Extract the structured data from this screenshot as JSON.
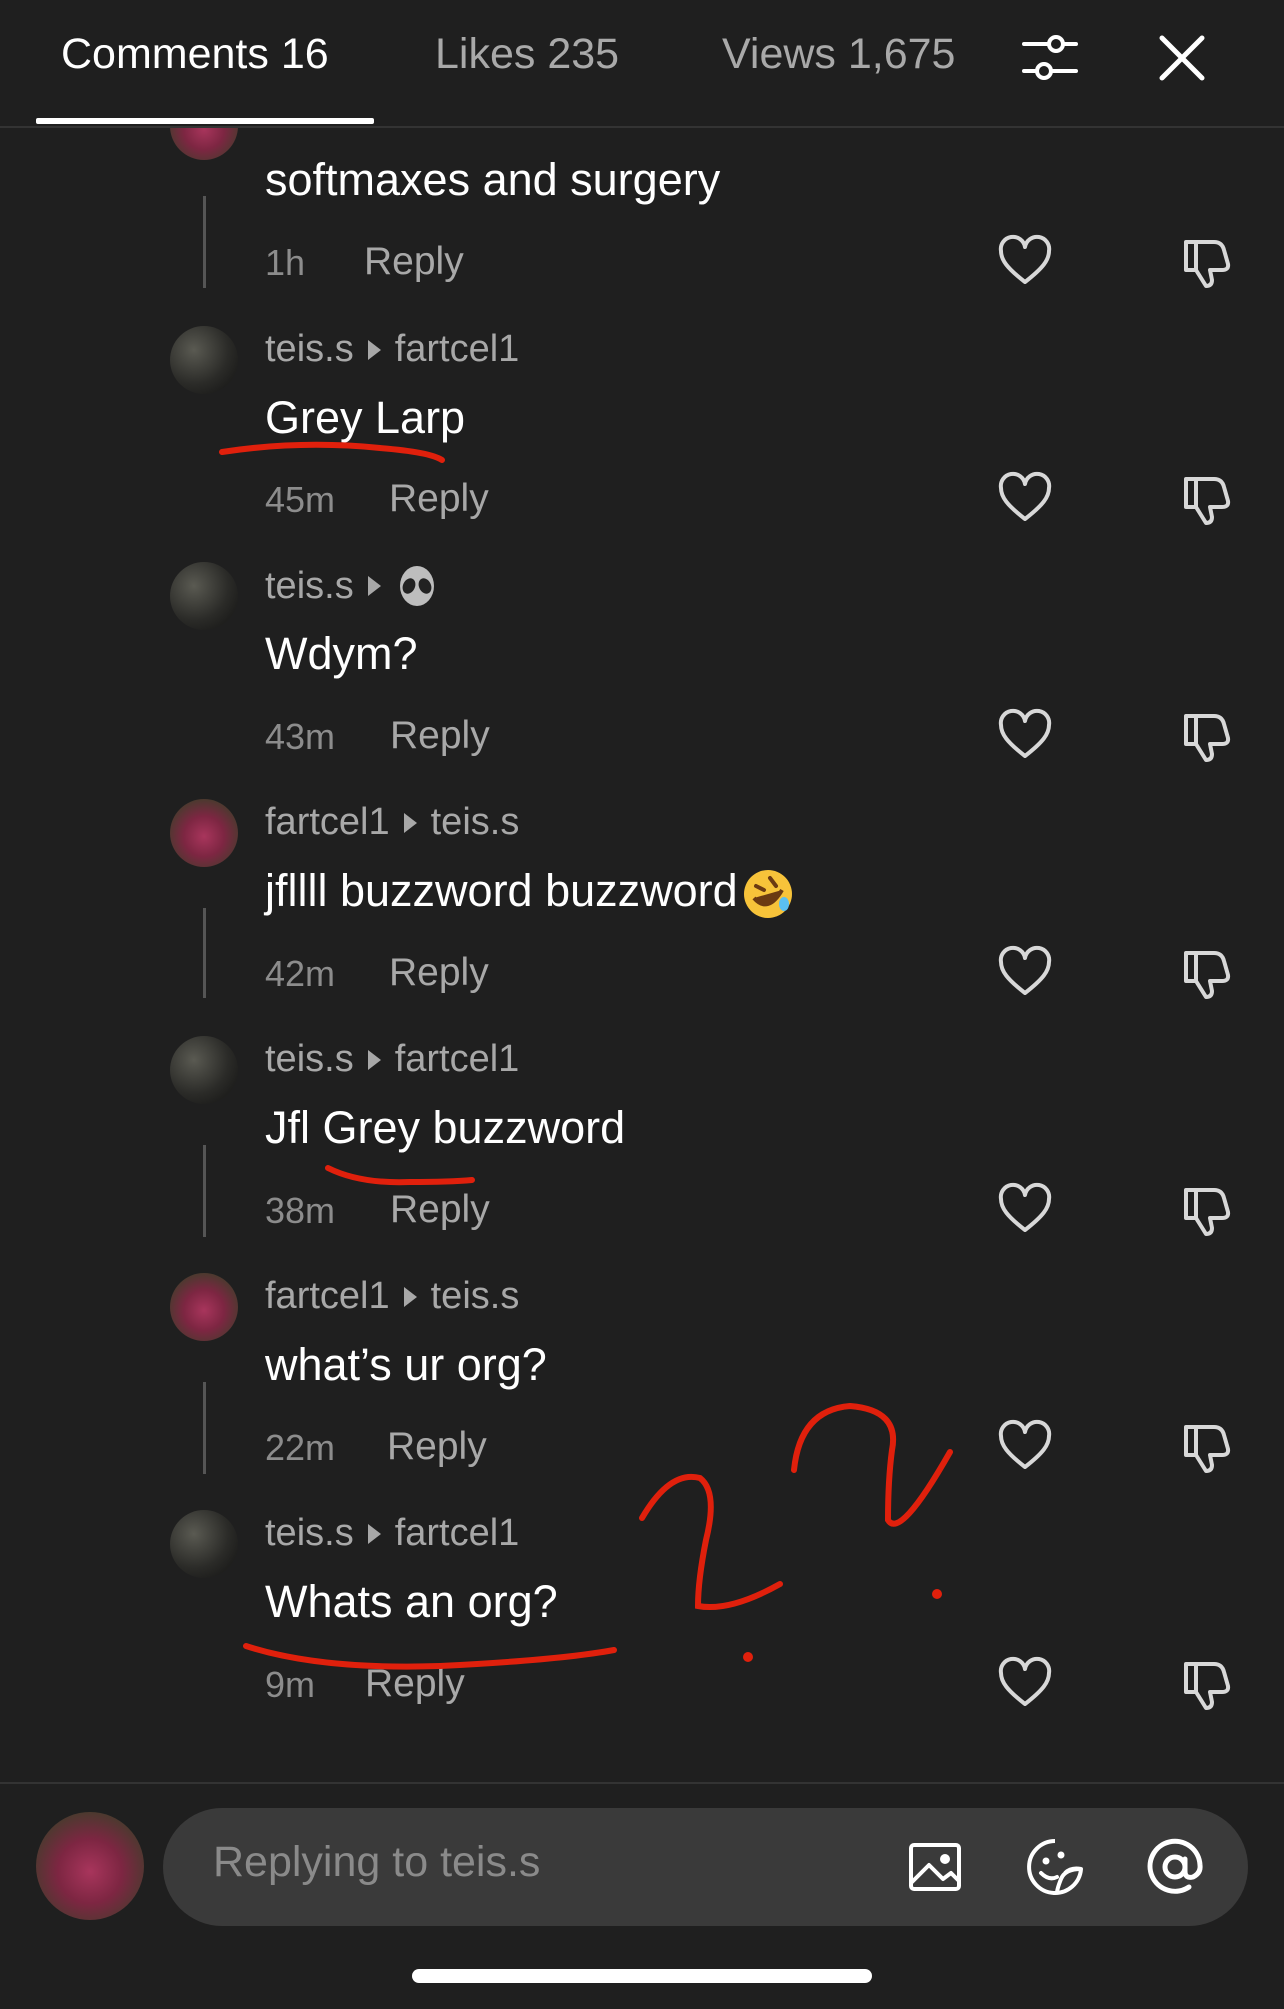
{
  "tabs": {
    "comments": "Comments 16",
    "likes": "Likes 235",
    "views": "Views 1,675"
  },
  "comments": [
    {
      "text": "softmaxes and surgery",
      "time": "1h",
      "reply": "Reply"
    },
    {
      "author": "teis.s",
      "target": "fartcel1",
      "text": "Grey Larp",
      "time": "45m",
      "reply": "Reply"
    },
    {
      "author": "teis.s",
      "target_icon": "alien-emoji",
      "text": "Wdym?",
      "time": "43m",
      "reply": "Reply"
    },
    {
      "author": "fartcel1",
      "target": "teis.s",
      "text": "jfllll buzzword buzzword",
      "emoji": "rofl-emoji",
      "time": "42m",
      "reply": "Reply"
    },
    {
      "author": "teis.s",
      "target": "fartcel1",
      "text": "Jfl Grey buzzword",
      "time": "38m",
      "reply": "Reply"
    },
    {
      "author": "fartcel1",
      "target": "teis.s",
      "text": "what’s ur org?",
      "time": "22m",
      "reply": "Reply"
    },
    {
      "author": "teis.s",
      "target": "fartcel1",
      "text": "Whats an org?",
      "time": "9m",
      "reply": "Reply"
    }
  ],
  "input": {
    "placeholder": "Replying to teis.s"
  },
  "icons": [
    "filter-icon",
    "close-icon",
    "heart-icon",
    "dislike-icon",
    "image-icon",
    "sticker-icon",
    "mention-icon"
  ],
  "colors": {
    "background": "#1f1f1f",
    "annotation": "#e0200c"
  }
}
